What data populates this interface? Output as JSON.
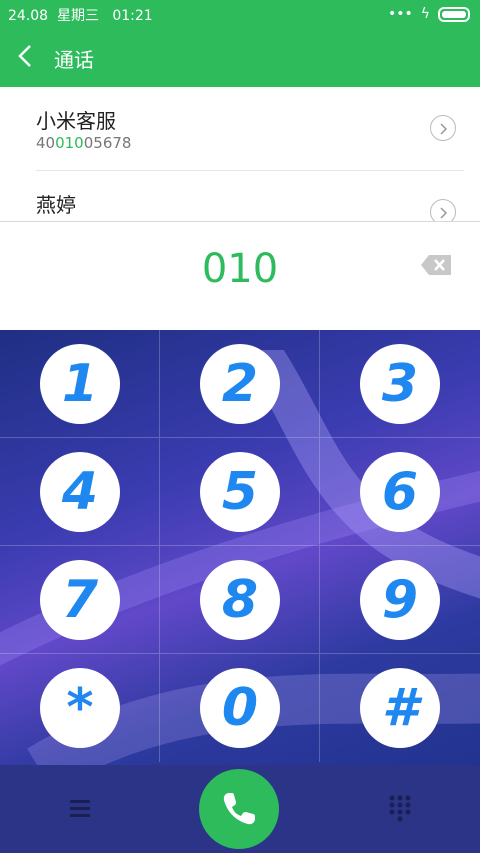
{
  "status_bar": {
    "date": "24.08",
    "weekday": "星期三",
    "time": "01:21"
  },
  "app_bar": {
    "title": "通话"
  },
  "results": [
    {
      "name": "小米客服",
      "number_prefix": "40",
      "number_match": "010",
      "number_suffix": "05678"
    },
    {
      "name": "燕婷",
      "number_prefix": "",
      "number_match": "",
      "number_suffix": ""
    }
  ],
  "dialed": "010",
  "keys": [
    "1",
    "2",
    "3",
    "4",
    "5",
    "6",
    "7",
    "8",
    "9",
    "*",
    "0",
    "#"
  ],
  "colors": {
    "accent": "#2dbb5c",
    "key_glyph": "#1e87f0",
    "bottom_bar": "#2b3487"
  },
  "icons": {
    "back": "chevron-left-icon",
    "more": "chevron-right-icon",
    "delete": "backspace-icon",
    "menu": "menu-icon",
    "call": "phone-icon",
    "dialpad": "dialpad-icon"
  }
}
